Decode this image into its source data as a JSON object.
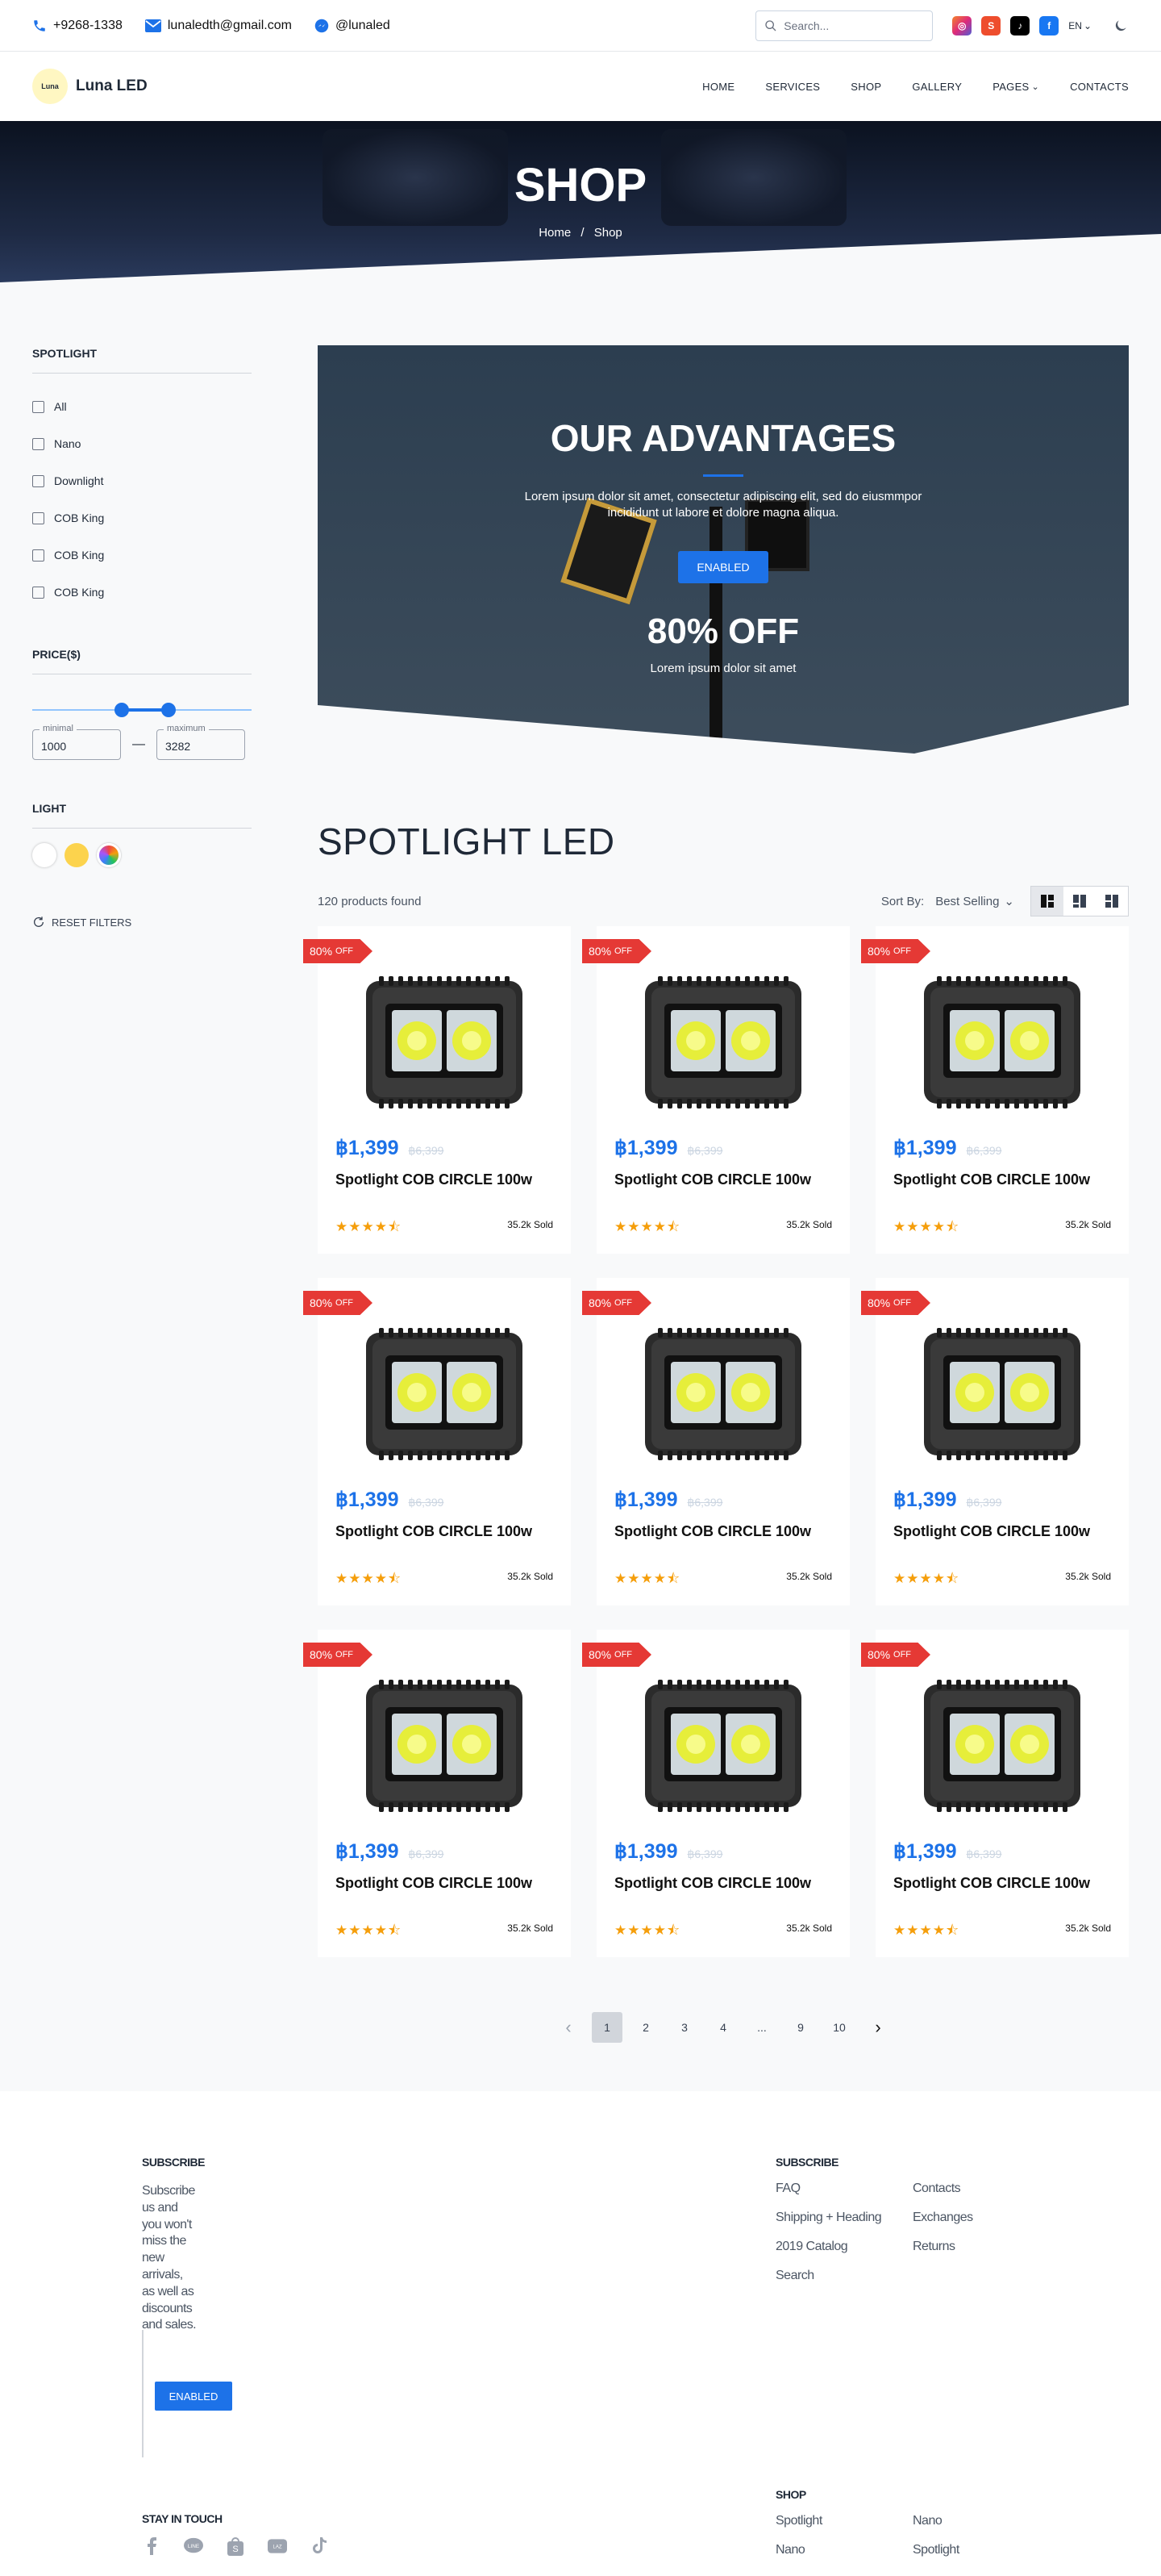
{
  "topbar": {
    "phone": "+9268-1338",
    "email": "lunaledth@gmail.com",
    "messenger": "@lunaled",
    "search_placeholder": "Search...",
    "lang": "EN",
    "social_icons": [
      "instagram-icon",
      "shopee-icon",
      "tiktok-icon",
      "facebook-icon"
    ]
  },
  "nav": {
    "brand": "Luna LED",
    "logo_text": "Luna",
    "menu": [
      "HOME",
      "SERVICES",
      "SHOP",
      "GALLERY",
      "PAGES",
      "CONTACTS"
    ]
  },
  "hero": {
    "title": "SHOP",
    "breadcrumb_home": "Home",
    "breadcrumb_sep": "/",
    "breadcrumb_current": "Shop"
  },
  "sidebar": {
    "spotlight_title": "SPOTLIGHT",
    "categories": [
      "All",
      "Nano",
      "Downlight",
      "COB King",
      "COB King",
      "COB King"
    ],
    "price_title": "PRICE($)",
    "min_label": "minimal",
    "min_value": "1000",
    "max_label": "maximum",
    "max_value": "3282",
    "range_dash": "—",
    "light_title": "LIGHT",
    "light_colors": [
      "#ffffff",
      "#fcd34d",
      "multicolor"
    ],
    "reset": "RESET FILTERS"
  },
  "promo": {
    "title": "OUR ADVANTAGES",
    "description": "Lorem ipsum dolor sit amet, consectetur adipiscing elit, sed do eiusmmpor incididunt ut labore et dolore magna aliqua.",
    "button": "ENABLED",
    "discount": "80% OFF",
    "discount_sub": "Lorem ipsum dolor sit amet"
  },
  "listing": {
    "title": "SPOTLIGHT LED",
    "count": "120 products found",
    "sort_label": "Sort By:",
    "sort_value": "Best Selling"
  },
  "products": [
    {
      "badge": "80%",
      "badge_suffix": "OFF",
      "price": "฿1,399",
      "old_price": "฿6,399",
      "name": "Spotlight COB CIRCLE 100w",
      "stars": "★★★★⯪",
      "rating": 4.5,
      "sold": "35.2k Sold"
    },
    {
      "badge": "80%",
      "badge_suffix": "OFF",
      "price": "฿1,399",
      "old_price": "฿6,399",
      "name": "Spotlight COB CIRCLE 100w",
      "stars": "★★★★⯪",
      "rating": 4.5,
      "sold": "35.2k Sold"
    },
    {
      "badge": "80%",
      "badge_suffix": "OFF",
      "price": "฿1,399",
      "old_price": "฿6,399",
      "name": "Spotlight COB CIRCLE 100w",
      "stars": "★★★★⯪",
      "rating": 4.5,
      "sold": "35.2k Sold"
    },
    {
      "badge": "80%",
      "badge_suffix": "OFF",
      "price": "฿1,399",
      "old_price": "฿6,399",
      "name": "Spotlight COB CIRCLE 100w",
      "stars": "★★★★⯪",
      "rating": 4.5,
      "sold": "35.2k Sold"
    },
    {
      "badge": "80%",
      "badge_suffix": "OFF",
      "price": "฿1,399",
      "old_price": "฿6,399",
      "name": "Spotlight COB CIRCLE 100w",
      "stars": "★★★★⯪",
      "rating": 4.5,
      "sold": "35.2k Sold"
    },
    {
      "badge": "80%",
      "badge_suffix": "OFF",
      "price": "฿1,399",
      "old_price": "฿6,399",
      "name": "Spotlight COB CIRCLE 100w",
      "stars": "★★★★⯪",
      "rating": 4.5,
      "sold": "35.2k Sold"
    },
    {
      "badge": "80%",
      "badge_suffix": "OFF",
      "price": "฿1,399",
      "old_price": "฿6,399",
      "name": "Spotlight COB CIRCLE 100w",
      "stars": "★★★★⯪",
      "rating": 4.5,
      "sold": "35.2k Sold"
    },
    {
      "badge": "80%",
      "badge_suffix": "OFF",
      "price": "฿1,399",
      "old_price": "฿6,399",
      "name": "Spotlight COB CIRCLE 100w",
      "stars": "★★★★⯪",
      "rating": 4.5,
      "sold": "35.2k Sold"
    },
    {
      "badge": "80%",
      "badge_suffix": "OFF",
      "price": "฿1,399",
      "old_price": "฿6,399",
      "name": "Spotlight COB CIRCLE 100w",
      "stars": "★★★★⯪",
      "rating": 4.5,
      "sold": "35.2k Sold"
    }
  ],
  "pagination": {
    "prev": "‹",
    "pages": [
      "1",
      "2",
      "3",
      "4",
      "...",
      "9",
      "10"
    ],
    "current": "1",
    "next": "›"
  },
  "footer": {
    "subscribe_title": "SUBSCRIBE",
    "subscribe_text": "Subscribe us and you won't miss the new arrivals, as well as discounts and sales.",
    "subscribe_button": "ENABLED",
    "links_title": "SUBSCRIBE",
    "links": [
      "FAQ",
      "Contacts",
      "Shipping + Heading",
      "Exchanges",
      "2019 Catalog",
      "Returns",
      "Search"
    ],
    "stay_title": "STAY IN TOUCH",
    "social_icons": [
      "facebook-icon",
      "line-icon",
      "shopee-icon",
      "lazada-icon",
      "tiktok-icon"
    ],
    "shop_title": "SHOP",
    "shop_links": [
      "Spotlight",
      "Nano",
      "Nano",
      "Spotlight"
    ]
  },
  "colors": {
    "accent": "#1d72e8",
    "badge": "#e53935",
    "stars": "#f59e0b",
    "hero_bg": "#0b1220"
  }
}
